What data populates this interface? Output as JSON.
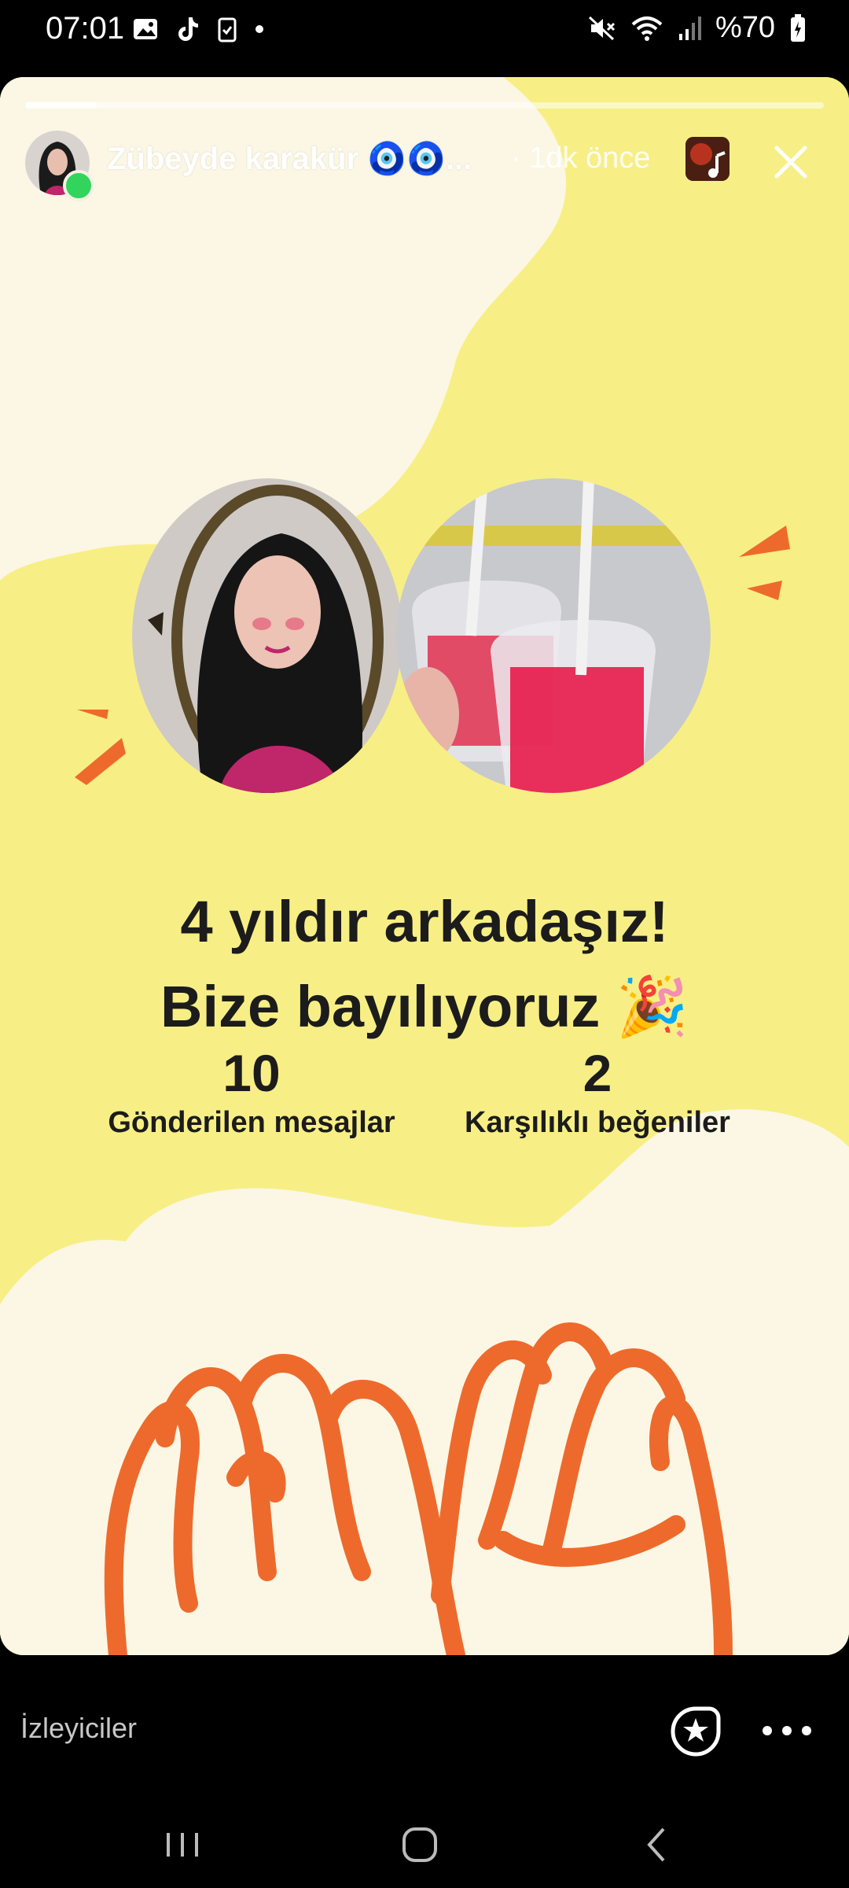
{
  "status_bar": {
    "time": "07:01",
    "battery": "%70"
  },
  "story": {
    "progress": 0.09,
    "username": "Zübeyde karakür 🧿🧿...",
    "time_ago": "· 1dk önce",
    "headline_line1": "4 yıldır arkadaşız!",
    "headline_line2": "Bize bayılıyoruz 🎉",
    "stats": [
      {
        "value": "10",
        "label": "Gönderilen mesajlar"
      },
      {
        "value": "2",
        "label": "Karşılıklı beğeniler"
      }
    ]
  },
  "bottom_bar": {
    "viewers_label": "İzleyiciler"
  },
  "icons": {
    "close": "close-icon",
    "sticker": "star-sticker-icon",
    "more": "more-dots-icon",
    "music": "music-note-icon"
  },
  "colors": {
    "story_background": "#f7ef85",
    "cream": "#fbf7e4",
    "accent_orange": "#ee6a2c",
    "online_green": "#31d55b",
    "headline_text": "#1c1c1c"
  }
}
